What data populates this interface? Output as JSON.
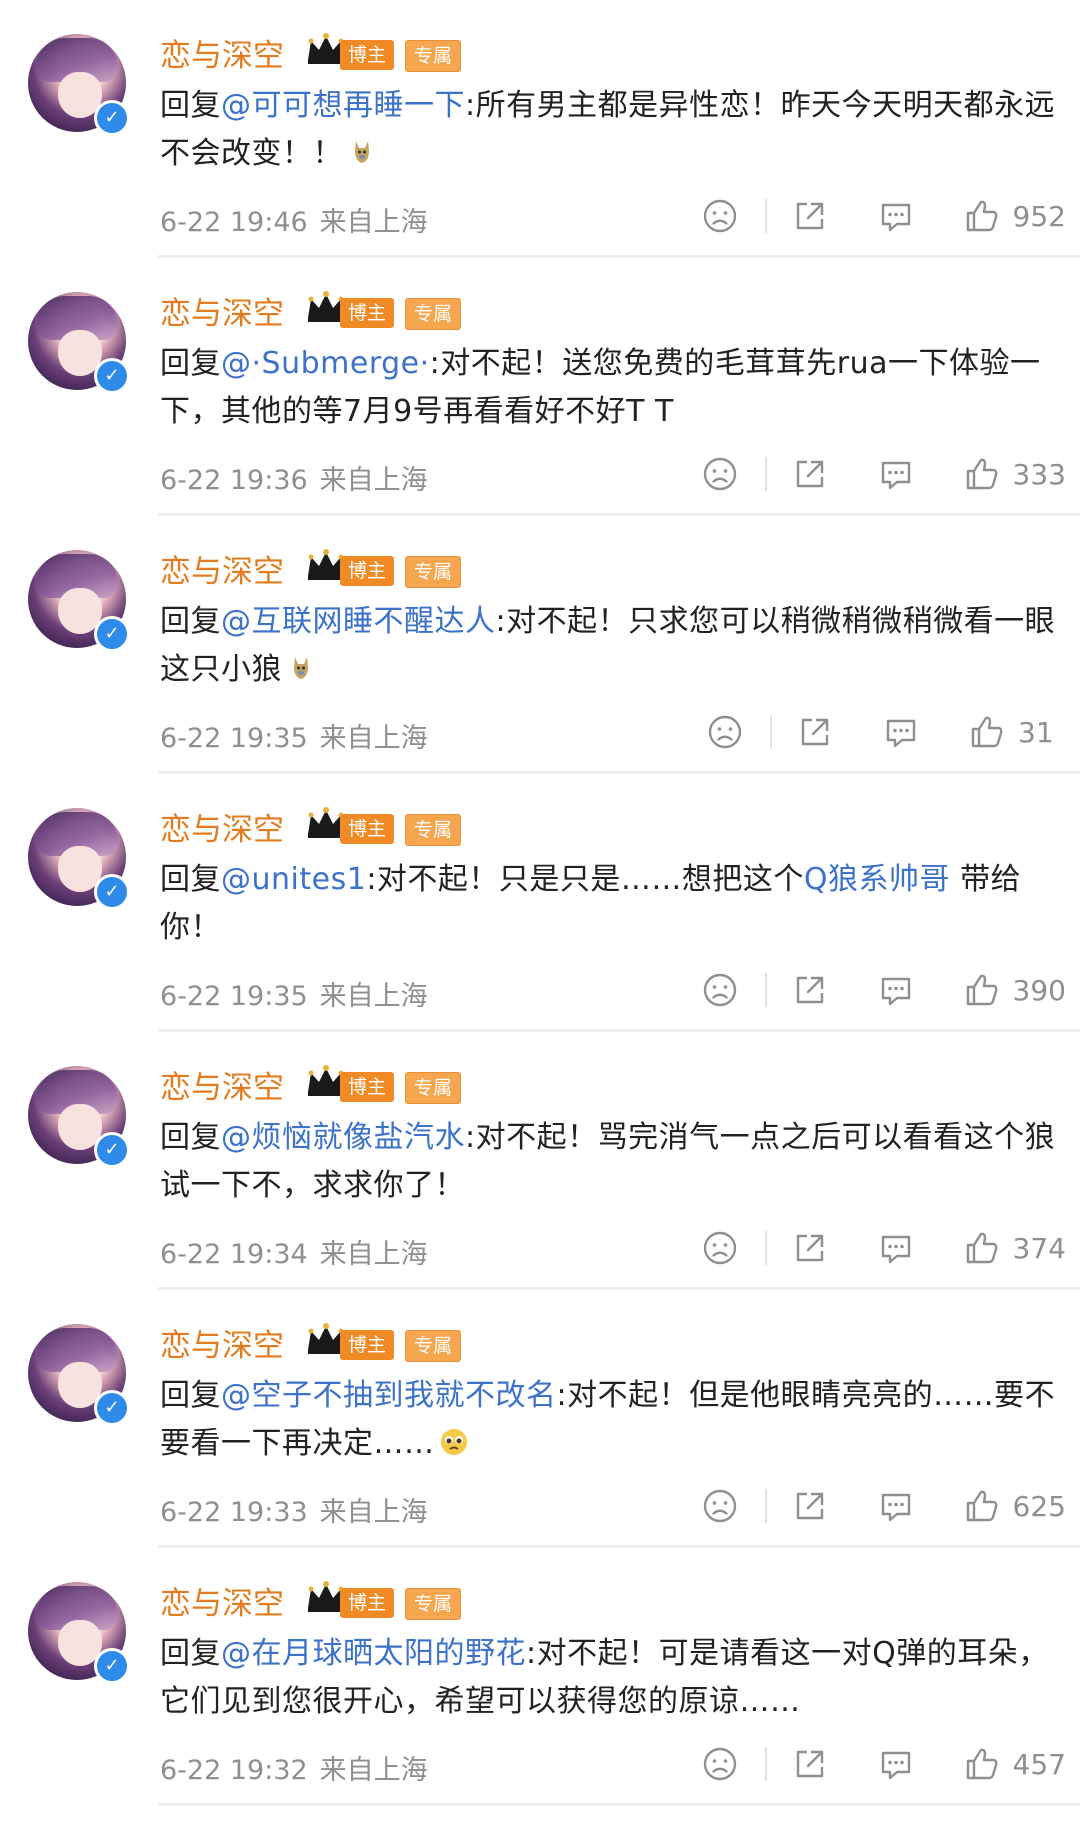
{
  "comments": [
    {
      "name": "恋与深空",
      "badge_blogger": "博主",
      "badge_exclusive": "专属",
      "reply_prefix": "回复",
      "mention": "@可可想再睡一下",
      "text": ":所有男主都是异性恋！昨天今天明天都永远不会改变！！",
      "emoji": "wolf-emoji",
      "topic": "",
      "tail": "",
      "time": "6-22 19:46",
      "source": "来自上海",
      "likes": "952"
    },
    {
      "name": "恋与深空",
      "badge_blogger": "博主",
      "badge_exclusive": "专属",
      "reply_prefix": "回复",
      "mention": "@·Submerge·",
      "text": ":对不起！送您免费的毛茸茸先rua一下体验一下，其他的等7月9号再看看好不好T T",
      "emoji": "",
      "topic": "",
      "tail": "",
      "time": "6-22 19:36",
      "source": "来自上海",
      "likes": "333"
    },
    {
      "name": "恋与深空",
      "badge_blogger": "博主",
      "badge_exclusive": "专属",
      "reply_prefix": "回复",
      "mention": "@互联网睡不醒达人",
      "text": ":对不起！只求您可以稍微稍微稍微看一眼这只小狼",
      "emoji": "wolf-emoji",
      "topic": "",
      "tail": "",
      "time": "6-22 19:35",
      "source": "来自上海",
      "likes": "31"
    },
    {
      "name": "恋与深空",
      "badge_blogger": "博主",
      "badge_exclusive": "专属",
      "reply_prefix": "回复",
      "mention": "@unites1",
      "text": ":对不起！只是只是……想把这个",
      "emoji": "",
      "topic": "Q狼系帅哥",
      "tail": " 带给你！",
      "time": "6-22 19:35",
      "source": "来自上海",
      "likes": "390"
    },
    {
      "name": "恋与深空",
      "badge_blogger": "博主",
      "badge_exclusive": "专属",
      "reply_prefix": "回复",
      "mention": "@烦恼就像盐汽水",
      "text": ":对不起！骂完消气一点之后可以看看这个狼试一下不，求求你了！",
      "emoji": "",
      "topic": "",
      "tail": "",
      "time": "6-22 19:34",
      "source": "来自上海",
      "likes": "374"
    },
    {
      "name": "恋与深空",
      "badge_blogger": "博主",
      "badge_exclusive": "专属",
      "reply_prefix": "回复",
      "mention": "@空子不抽到我就不改名",
      "text": ":对不起！但是他眼睛亮亮的……要不要看一下再决定……",
      "emoji": "pleading-face-emoji",
      "topic": "",
      "tail": "",
      "time": "6-22 19:33",
      "source": "来自上海",
      "likes": "625"
    },
    {
      "name": "恋与深空",
      "badge_blogger": "博主",
      "badge_exclusive": "专属",
      "reply_prefix": "回复",
      "mention": "@在月球晒太阳的野花",
      "text": ":对不起！可是请看这一对Q弹的耳朵，它们见到您很开心，希望可以获得您的原谅……",
      "emoji": "",
      "topic": "",
      "tail": "",
      "time": "6-22 19:32",
      "source": "来自上海",
      "likes": "457"
    }
  ],
  "icons": {
    "dislike": "frown-face-icon",
    "share": "share-icon",
    "reply": "comment-icon",
    "like": "thumbs-up-icon",
    "verified": "verified-badge-icon",
    "crown": "crown-icon"
  },
  "colors": {
    "name": "#e47c1f",
    "mention": "#3c72c9",
    "meta": "#8f8f8f",
    "verified": "#2f8bea",
    "badge_blogger": "#f08a24",
    "badge_exclusive": "#f5a64e"
  }
}
